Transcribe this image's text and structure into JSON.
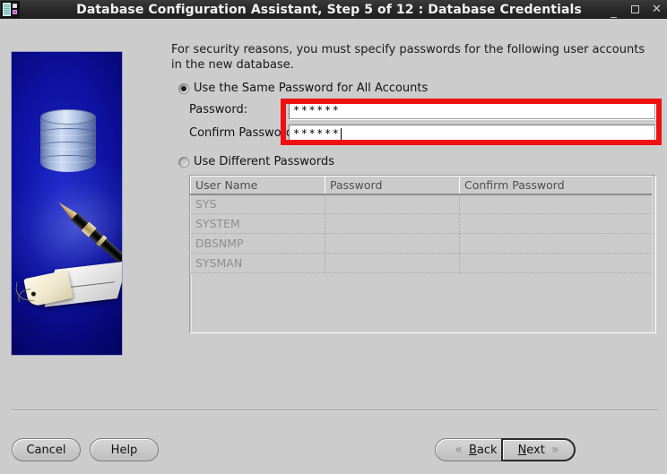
{
  "window": {
    "title": "Database Configuration Assistant, Step 5 of 12 : Database Credentials",
    "icon": "database-app-icon",
    "controls": {
      "minimize": "_",
      "maximize": "□",
      "close": "✕"
    }
  },
  "sidebar": {
    "graphic_alt": "database-cylinder-pen-tag-illustration"
  },
  "main": {
    "instructions": "For security reasons, you must specify passwords for the following user accounts in the new database.",
    "options": [
      {
        "id": "same-password",
        "label": "Use the Same Password for All Accounts",
        "selected": true
      },
      {
        "id": "different-passwords",
        "label": "Use Different Passwords",
        "selected": false
      }
    ],
    "fields": {
      "password": {
        "label": "Password:",
        "value": "******",
        "masked_length": 6,
        "focused": false
      },
      "confirm_password": {
        "label": "Confirm Password",
        "value": "******",
        "masked_length": 6,
        "focused": true
      }
    },
    "annotation": {
      "type": "highlight-rectangle",
      "color": "#ee1111",
      "target": "password-fields"
    },
    "table": {
      "headers": [
        "User Name",
        "Password",
        "Confirm Password"
      ],
      "rows": [
        {
          "user": "SYS",
          "password": "",
          "confirm": ""
        },
        {
          "user": "SYSTEM",
          "password": "",
          "confirm": ""
        },
        {
          "user": "DBSNMP",
          "password": "",
          "confirm": ""
        },
        {
          "user": "SYSMAN",
          "password": "",
          "confirm": ""
        }
      ],
      "enabled": false
    }
  },
  "footer": {
    "cancel": "Cancel",
    "help": "Help",
    "back": "Back",
    "next": "Next",
    "back_chevron": "«",
    "next_chevron": "»"
  },
  "colors": {
    "window_bg": "#cccccc",
    "titlebar_bg": "#2b2b2b",
    "titlebar_text": "#f2f2f2",
    "annotation_red": "#ee1111",
    "sidebar_blue": "#0d11a0",
    "disabled_text": "#8e8e8e"
  }
}
